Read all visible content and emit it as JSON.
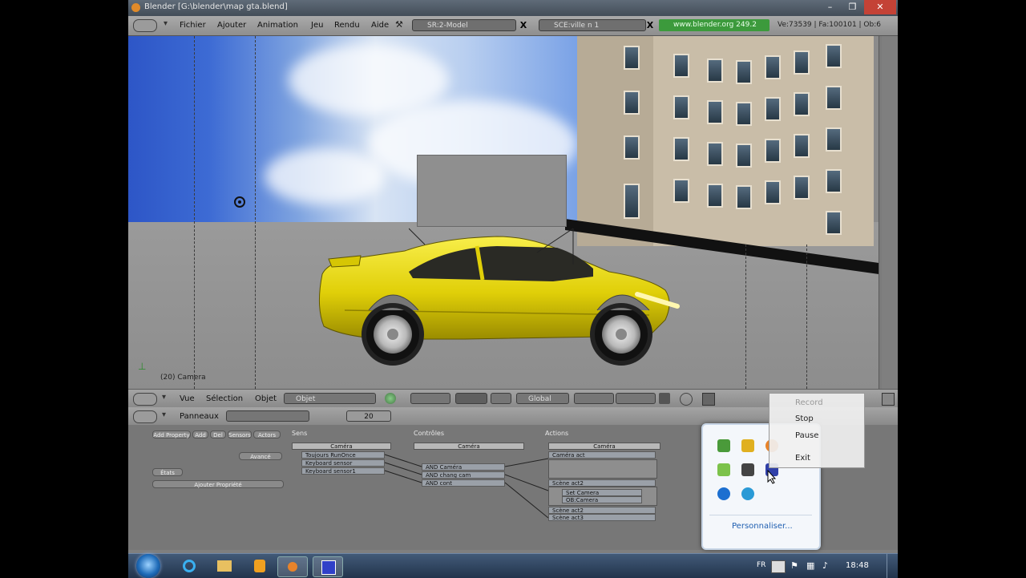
{
  "window": {
    "title": "Blender [G:\\blender\\map gta.blend]",
    "controls": [
      "–",
      "❐",
      "✕"
    ]
  },
  "menubar": {
    "items": [
      "Fichier",
      "Ajouter",
      "Animation",
      "Jeu",
      "Rendu",
      "Aide"
    ],
    "screen": "SR:2-Model",
    "scene": "SCE:ville n 1",
    "url": "www.blender.org 249.2",
    "stats": "Ve:73539 | Fa:100101 | Ob:6"
  },
  "viewport": {
    "label": "(20) Camera"
  },
  "view_header": {
    "menus": [
      "Vue",
      "Sélection",
      "Objet"
    ],
    "mode": "Objet",
    "orientation": "Global"
  },
  "logic_panel": {
    "header_label": "Panneaux",
    "frame": "20",
    "col1": {
      "buttons": [
        "Add Property",
        "Add",
        "Del",
        "Sensors",
        "Actors"
      ],
      "advanced": "Avancé",
      "states": "États",
      "add_property": "Ajouter Propriété"
    },
    "sensors": {
      "label": "Sens",
      "object": "Caméra",
      "rows": [
        "Toujours  RunOnce",
        "Keyboard  sensor",
        "Keyboard  sensor1"
      ]
    },
    "controllers": {
      "label": "Contrôles",
      "object": "Caméra",
      "rows": [
        "AND   Caméra",
        "AND   chang cam",
        "AND   cont"
      ]
    },
    "actuators": {
      "label": "Actions",
      "object": "Caméra",
      "rows": [
        "Caméra    act",
        "Scène    act2",
        "Set Camera",
        "OB:Camera",
        "Scène    act2",
        "Scène    act3"
      ]
    }
  },
  "tray_popup": {
    "customize": "Personnaliser..."
  },
  "context_menu": {
    "items": [
      "Record",
      "Stop",
      "Pause",
      "Exit"
    ]
  },
  "taskbar": {
    "lang": "FR",
    "clock": "18:48"
  },
  "colors": {
    "car": "#e8d70a",
    "sky": "#2d56c7",
    "url_green": "#3c9a3c"
  }
}
